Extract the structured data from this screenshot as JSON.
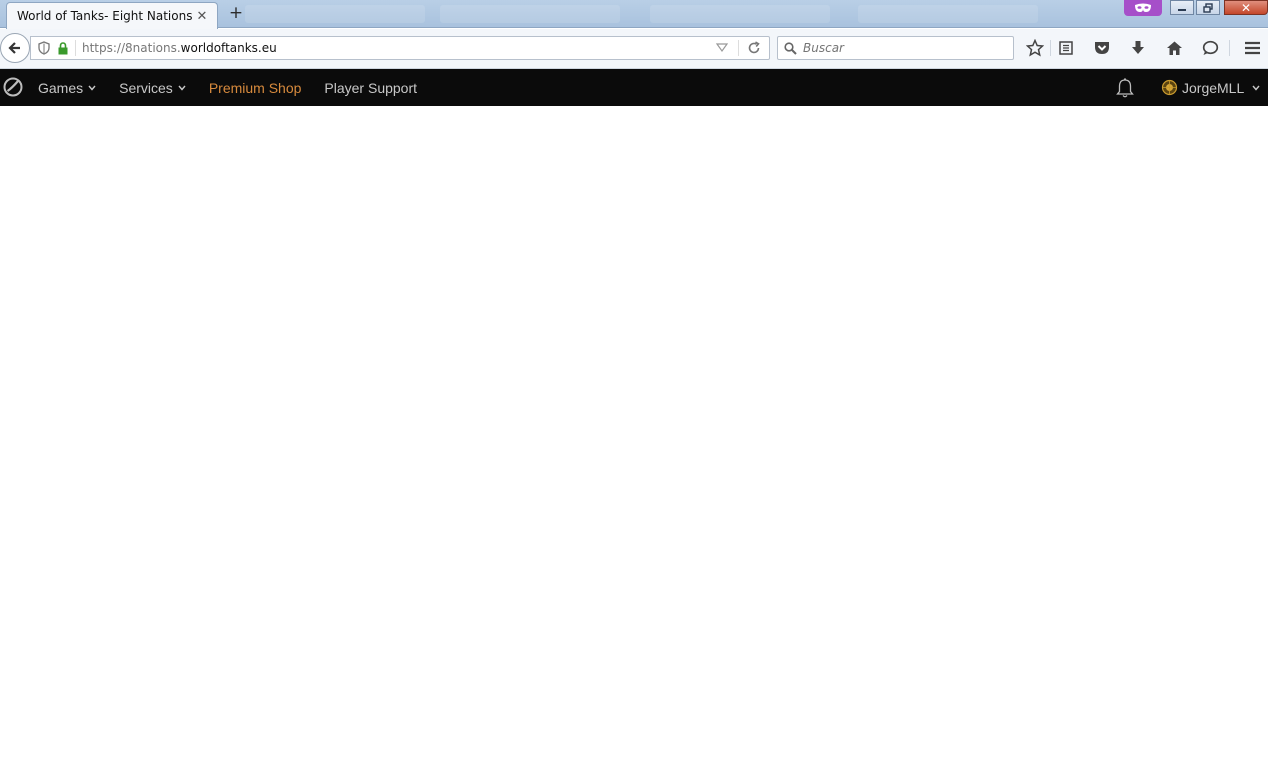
{
  "browser": {
    "tab": {
      "title": "World of Tanks- Eight Nations",
      "close": "✕"
    },
    "new_tab": "+",
    "window_controls": {
      "close": "✕"
    },
    "url": {
      "prefix": "https://8nations.",
      "domain": "worldoftanks.eu"
    },
    "search": {
      "placeholder": "Buscar"
    },
    "toolbar_icons": [
      "star-icon",
      "reading-list-icon",
      "pocket-icon",
      "download-icon",
      "home-icon",
      "chat-icon",
      "menu-icon"
    ]
  },
  "site": {
    "nav": [
      {
        "label": "Games",
        "dropdown": true
      },
      {
        "label": "Services",
        "dropdown": true
      },
      {
        "label": "Premium Shop",
        "dropdown": false
      },
      {
        "label": "Player Support",
        "dropdown": false
      }
    ],
    "user": {
      "name": "JorgeMLL"
    },
    "colors": {
      "header_bg": "#0b0b0b",
      "nav_text": "#c8c8c8",
      "premium": "#d78a3d",
      "private_mask": "#a64fc9"
    }
  }
}
